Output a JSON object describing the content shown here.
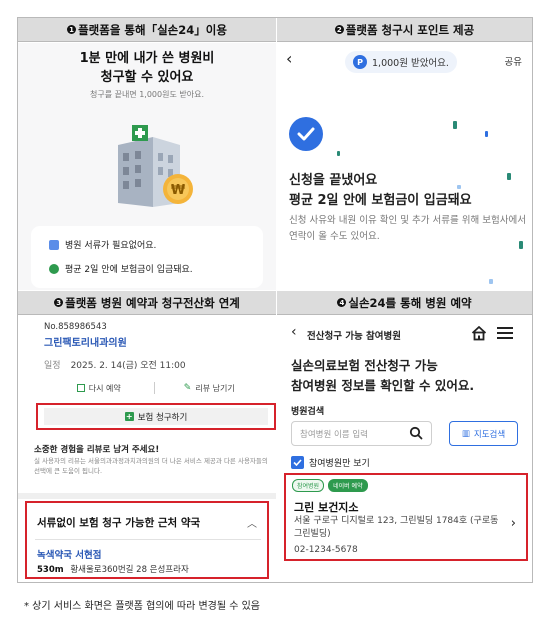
{
  "panels": {
    "p1": {
      "num": "1",
      "header": "플랫폼을 통해「실손24」이용",
      "title_line1": "1분 만에 내가 쓴 병원비",
      "title_line2": "청구할 수 있어요",
      "subtitle": "청구를 끝내면 1,000원도 받아요.",
      "bullets": [
        "병원 서류가 필요없어요.",
        "평균 2일 안에 보험금이 입금돼요."
      ]
    },
    "p2": {
      "num": "2",
      "header": "플랫폼 청구시 포인트 제공",
      "back_icon": "‹",
      "point_badge": "P",
      "point_text": "1,000원 받았어요.",
      "share": "공유",
      "done_line1": "신청을 끝냈어요",
      "done_line2": "평균 2일 안에 보험금이 입금돼요",
      "desc": "신청 사유와 내원 이유 확인 및 추가 서류를 위해 보험사에서 연락이 올 수도 있어요."
    },
    "p3": {
      "num": "3",
      "header": "플랫폼 병원 예약과 청구전산화 연계",
      "order_no": "No.858986543",
      "clinic": "그린팩토리내과의원",
      "date_label": "일정",
      "date_value": "2025. 2. 14(금) 오전 11:00",
      "rebook": "다시 예약",
      "review": "리뷰 남기기",
      "claim": "보험 청구하기",
      "review_title": "소중한 경험을 리뷰로 남겨 주세요!",
      "review_sub": "실 사용자의 리뷰는 서울의과과정과치과의원의 더 나은 서비스 제공과 다른 사용자들의 선택에 큰 도움이 됩니다.",
      "pharmacy_title": "서류없이 보험 청구 가능한 근처 약국",
      "pharmacy_name": "녹색약국 서현점",
      "pharmacy_dist": "530m",
      "pharmacy_addr": "황새울로360번길 28 은성프라자"
    },
    "p4": {
      "num": "4",
      "header": "실손24를 통해 병원 예약",
      "page_title": "전산청구 가능 참여병원",
      "headline_1": "실손의료보험 전산청구 가능",
      "headline_2": "참여병원 정보를 확인할 수 있어요.",
      "search_label": "병원검색",
      "search_placeholder": "참여병원 이름 입력",
      "map_button": "지도검색",
      "checkbox_label": "참여병원만 보기",
      "tags": [
        "참여병원",
        "네이버 예약"
      ],
      "hospital_name": "그린 보건지소",
      "hospital_addr": "서울 구로구 디지털로 123, 그린빌딩 1784호 (구로동 그린빌딩)",
      "hospital_phone": "02-1234-5678"
    }
  },
  "footnote": "* 상기 서비스 화면은 플랫폼 협의에 따라 변경될 수 있음",
  "colors": {
    "accent": "#2f6fe0",
    "highlight": "#d6222b",
    "green": "#2e9a4e",
    "header_bg": "#dcdcdc"
  }
}
